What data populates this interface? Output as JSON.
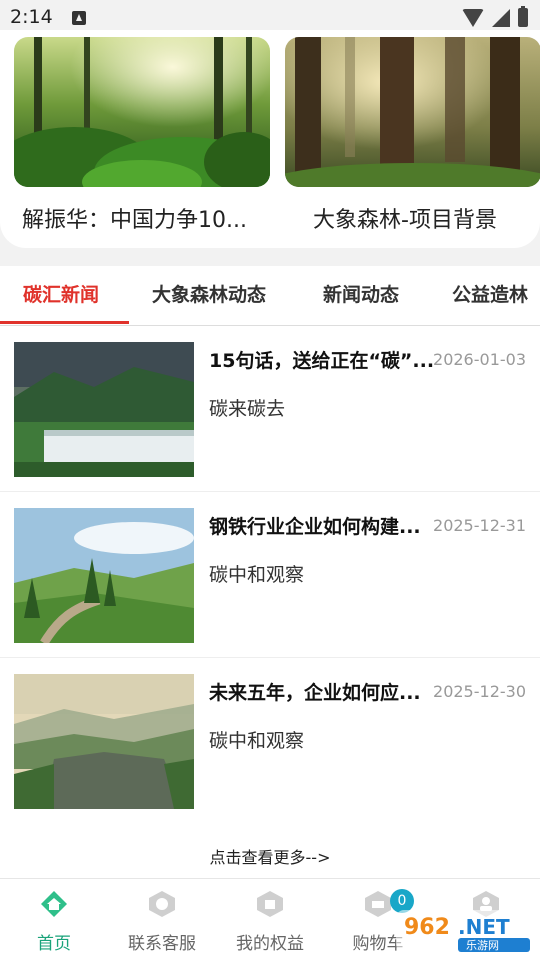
{
  "status_bar": {
    "time": "2:14"
  },
  "featured": [
    {
      "caption": "解振华：中国力争10..."
    },
    {
      "caption": "大象森林-项目背景"
    }
  ],
  "tabs": [
    "碳汇新闻",
    "大象森林动态",
    "新闻动态",
    "公益造林"
  ],
  "active_tab": 0,
  "news": [
    {
      "title": "15句话，送给正在“碳”...",
      "date": "2026-01-03",
      "source": "碳来碳去"
    },
    {
      "title": "钢铁行业企业如何构建...",
      "date": "2025-12-31",
      "source": "碳中和观察"
    },
    {
      "title": "未来五年，企业如何应...",
      "date": "2025-12-30",
      "source": "碳中和观察"
    }
  ],
  "more_link": "点击查看更多-->",
  "bottom_nav": [
    {
      "label": "首页",
      "icon": "home-icon",
      "active": true
    },
    {
      "label": "联系客服",
      "icon": "customer-service-icon",
      "active": false
    },
    {
      "label": "我的权益",
      "icon": "benefits-icon",
      "active": false
    },
    {
      "label": "购物车",
      "icon": "cart-icon",
      "active": false,
      "badge": "0"
    },
    {
      "label": "",
      "icon": "profile-icon",
      "active": false
    }
  ],
  "watermark": "962.NET 乐游网",
  "colors": {
    "accent": "#e0322b",
    "nav_active": "#1aa37a",
    "badge": "#19a7c8"
  }
}
